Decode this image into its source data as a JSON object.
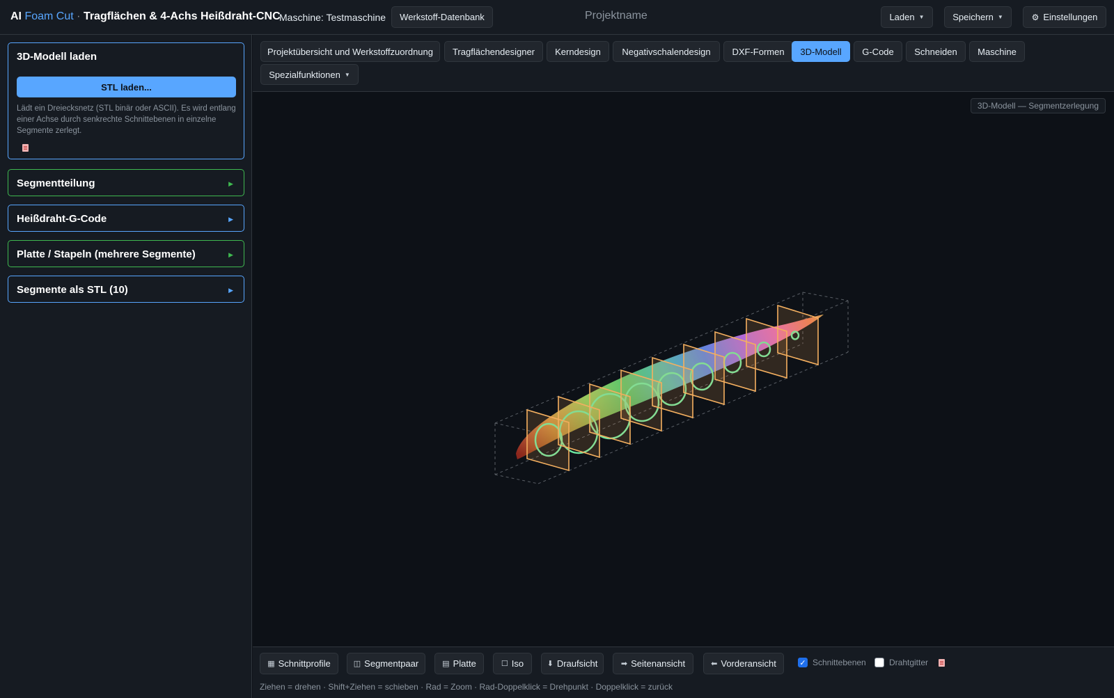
{
  "header": {
    "title_prefix": "AI",
    "title_accent": "Foam Cut",
    "title_sep": "·",
    "title_rest": "Tragflächen & 4-Achs Heißdraht-CNC",
    "machine_label": "Maschine: Testmaschine",
    "material_db_button": "Werkstoff-Datenbank",
    "project_name": "Projektname",
    "load_button": "Laden",
    "save_button": "Speichern",
    "settings_button": "Einstellungen"
  },
  "sidebar": {
    "load_panel": {
      "title": "3D-Modell laden",
      "button": "STL laden...",
      "description": "Lädt ein Dreiecksnetz (STL binär oder ASCII). Es wird entlang einer Achse durch senkrechte Schnittebenen in einzelne Segmente zerlegt."
    },
    "panels": [
      {
        "label": "Segmentteilung",
        "color": "green"
      },
      {
        "label": "Heißdraht-G-Code",
        "color": "blue"
      },
      {
        "label": "Platte / Stapeln (mehrere Segmente)",
        "color": "green"
      },
      {
        "label": "Segmente als STL (10)",
        "color": "blue"
      }
    ]
  },
  "tabs": [
    "Projektübersicht und Werkstoffzuordnung",
    "Tragflächendesigner",
    "Kerndesign",
    "Negativschalendesign",
    "DXF-Formen",
    "3D-Modell",
    "G-Code",
    "Schneiden",
    "Maschine",
    "Spezialfunktionen"
  ],
  "active_tab": "3D-Modell",
  "viewport": {
    "label": "3D-Modell — Segmentzerlegung"
  },
  "toolbar": {
    "buttons": [
      {
        "icon": "▦",
        "label": "Schnittprofile",
        "icon_name": "grid-icon"
      },
      {
        "icon": "◫",
        "label": "Segmentpaar",
        "icon_name": "split-icon"
      },
      {
        "icon": "▤",
        "label": "Platte",
        "icon_name": "plate-icon"
      },
      {
        "icon": "☐",
        "label": "Iso",
        "icon_name": "cube-icon"
      },
      {
        "icon": "⬇",
        "label": "Draufsicht",
        "icon_name": "arrow-down-icon"
      },
      {
        "icon": "➡",
        "label": "Seitenansicht",
        "icon_name": "arrow-right-icon"
      },
      {
        "icon": "⬅",
        "label": "Vorderansicht",
        "icon_name": "arrow-left-icon"
      }
    ],
    "checkbox_planes": {
      "label": "Schnittebenen",
      "checked": true
    },
    "checkbox_wire": {
      "label": "Drahtgitter",
      "checked": false
    },
    "hint": "Ziehen = drehen · Shift+Ziehen = schieben · Rad = Zoom · Rad-Doppelklick = Drehpunkt · Doppelklick = zurück"
  },
  "colors": {
    "accent": "#58a6ff",
    "panel_green": "#3fb950",
    "plane": "#f0a050",
    "section_ring": "#6ee7a0"
  }
}
